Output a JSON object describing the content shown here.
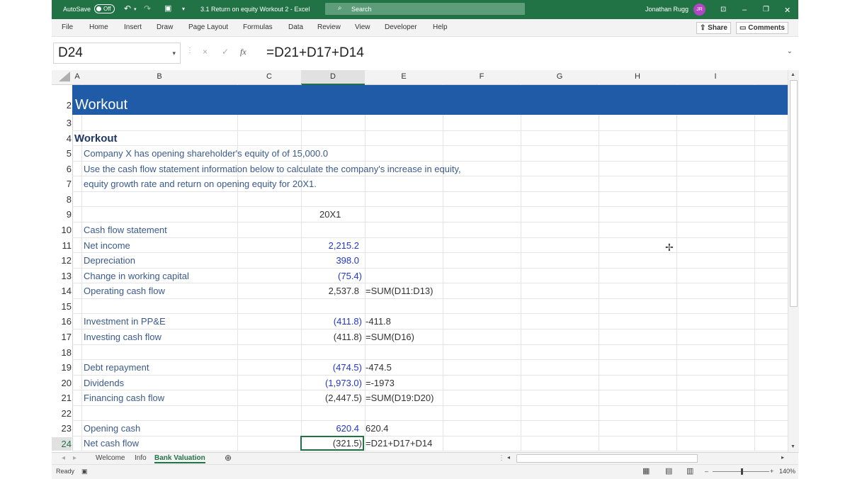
{
  "titlebar": {
    "autosave": "AutoSave",
    "autosave_state": "Off",
    "doc_title": "3.1 Return on equity Workout 2  -  Excel",
    "search": "Search",
    "user": "Jonathan Rugg",
    "initials": "JR"
  },
  "menu": [
    "File",
    "Home",
    "Insert",
    "Draw",
    "Page Layout",
    "Formulas",
    "Data",
    "Review",
    "View",
    "Developer",
    "Help"
  ],
  "share": "Share",
  "comments": "Comments",
  "formula_bar": {
    "name_box": "D24",
    "fx": "fx",
    "formula": "=D21+D17+D14"
  },
  "columns": [
    "A",
    "B",
    "C",
    "D",
    "E",
    "F",
    "G",
    "H",
    "I"
  ],
  "rows": [
    "2",
    "3",
    "4",
    "5",
    "6",
    "7",
    "8",
    "9",
    "10",
    "11",
    "12",
    "13",
    "14",
    "15",
    "16",
    "17",
    "18",
    "19",
    "20",
    "21",
    "22",
    "23",
    "24"
  ],
  "sheet": {
    "banner": "Workout",
    "heading": "Workout",
    "intro1": "Company X has opening shareholder's equity of of 15,000.0",
    "intro2": "Use the cash flow statement information below to calculate the company's increase in equity,",
    "intro3": "equity growth rate and return on opening equity for 20X1.",
    "year": "20X1",
    "section": "Cash flow statement",
    "lines": [
      {
        "label": "Net income",
        "value": "2,215.2",
        "note": ""
      },
      {
        "label": "Depreciation",
        "value": "398.0",
        "note": ""
      },
      {
        "label": "Change in working capital",
        "value": "(75.4)",
        "note": ""
      },
      {
        "label": "Operating cash flow",
        "value": "2,537.8",
        "note": "=SUM(D11:D13)"
      },
      {
        "label": "Investment in PP&E",
        "value": "(411.8)",
        "note": "-411.8"
      },
      {
        "label": "Investing cash flow",
        "value": "(411.8)",
        "note": "=SUM(D16)"
      },
      {
        "label": "Debt repayment",
        "value": "(474.5)",
        "note": "-474.5"
      },
      {
        "label": "Dividends",
        "value": "(1,973.0)",
        "note": "=-1973"
      },
      {
        "label": "Financing cash flow",
        "value": "(2,447.5)",
        "note": "=SUM(D19:D20)"
      },
      {
        "label": "Opening cash",
        "value": "620.4",
        "note": "620.4"
      },
      {
        "label": "Net cash flow",
        "value": "(321.5)",
        "note": "=D21+D17+D14"
      }
    ]
  },
  "tabs": [
    "Welcome",
    "Info",
    "Bank Valuation"
  ],
  "status": {
    "ready": "Ready",
    "zoom": "140%"
  }
}
